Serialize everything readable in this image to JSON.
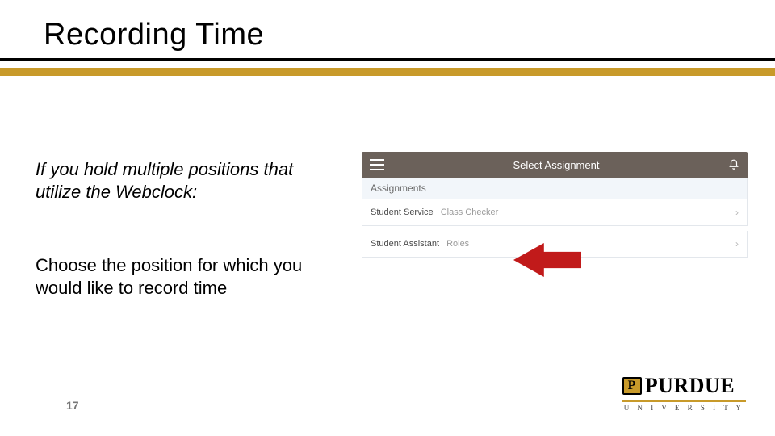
{
  "title": "Recording Time",
  "body": {
    "para1": "If you hold multiple positions that utilize the Webclock:",
    "para2": "Choose the position for which you would like to record time"
  },
  "mock": {
    "header": "Select Assignment",
    "section": "Assignments",
    "rows": [
      {
        "main": "Student Service",
        "sub": "Class Checker"
      },
      {
        "main": "Student Assistant",
        "sub": "Roles"
      }
    ]
  },
  "logo": {
    "brand": "PURDUE",
    "sub": "U N I V E R S I T Y"
  },
  "page": "17",
  "colors": {
    "gold": "#c89a2a",
    "headerBrown": "#6b615a",
    "arrowRed": "#c11a1a"
  }
}
